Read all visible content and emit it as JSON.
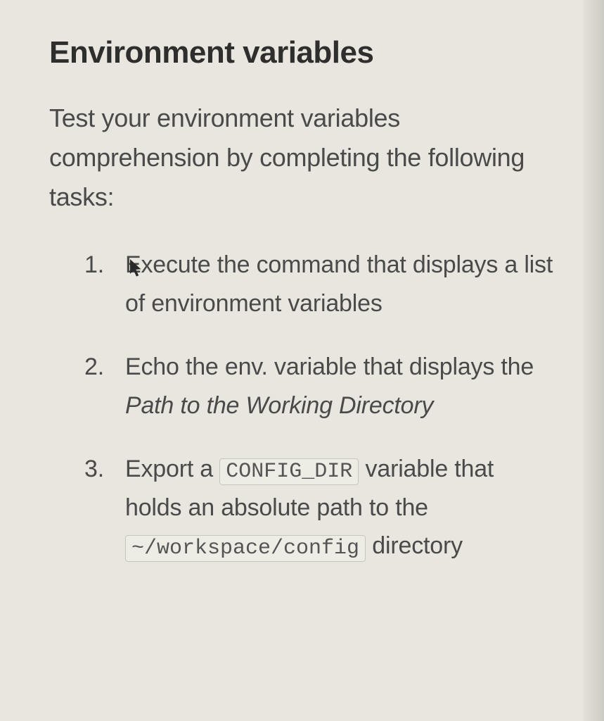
{
  "heading": "Environment variables",
  "intro": "Test your environment variables comprehension by completing the following tasks:",
  "tasks": {
    "t1": "Execute the command that displays a list of environment variables",
    "t2_a": "Echo the env. variable that displays the ",
    "t2_b": "Path to the Working Directory",
    "t3_a": "Export a ",
    "t3_code1": "CONFIG_DIR",
    "t3_b": " variable that holds an absolute path to the ",
    "t3_code2": "~/workspace/config",
    "t3_c": " directory"
  }
}
